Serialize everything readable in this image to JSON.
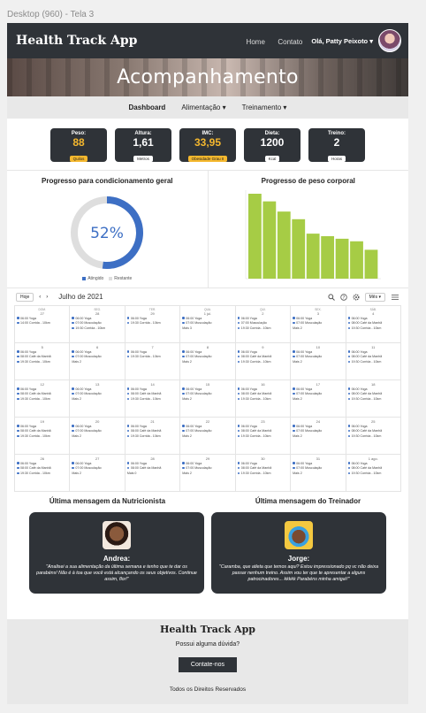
{
  "canvas_label": "Desktop (960) - Tela 3",
  "header": {
    "brand": "Health Track App",
    "nav": [
      "Home",
      "Contato"
    ],
    "user_label": "Olá, Patty Peixoto ▾"
  },
  "hero_title": "Acompanhamento",
  "subnav": [
    {
      "label": "Dashboard",
      "active": true
    },
    {
      "label": "Alimentação ▾",
      "active": false
    },
    {
      "label": "Treinamento ▾",
      "active": false
    }
  ],
  "stats": [
    {
      "label": "Peso:",
      "value": "88",
      "unit": "Quilos",
      "highlight": true
    },
    {
      "label": "Altura:",
      "value": "1,61",
      "unit": "Metros",
      "highlight": false
    },
    {
      "label": "IMC:",
      "value": "33,95",
      "unit": "Obesidade Grau II",
      "highlight": true
    },
    {
      "label": "Dieta:",
      "value": "1200",
      "unit": "Kcal",
      "highlight": false
    },
    {
      "label": "Treino:",
      "value": "2",
      "unit": "Horas",
      "highlight": false
    }
  ],
  "chart_data": [
    {
      "type": "pie",
      "title": "Progresso para condicionamento geral",
      "center_label": "52%",
      "slices": [
        {
          "name": "Atingido",
          "value": 52,
          "color": "#3d6fc4"
        },
        {
          "name": "Restante",
          "value": 48,
          "color": "#dedede"
        }
      ],
      "legend": "bottom"
    },
    {
      "type": "bar",
      "title": "Progresso de peso corporal",
      "values": [
        100,
        91,
        79,
        70,
        53,
        50,
        47,
        44,
        34
      ],
      "color": "#a6cc45",
      "ylim": [
        0,
        100
      ],
      "grid": false
    }
  ],
  "calendar": {
    "today_label": "Hoje",
    "prev": "‹",
    "next": "›",
    "month_label": "Julho de 2021",
    "view_label": "Mês ▾",
    "weekdays": [
      "DOM.",
      "SEG.",
      "TER.",
      "QUA.",
      "QUI.",
      "SEX.",
      "SÁB."
    ],
    "weeks": [
      [
        {
          "day": "27",
          "events": [
            "06:00 Yoga",
            "14:00 Corrida - 10km"
          ]
        },
        {
          "day": "28",
          "events": [
            "06:00 Yoga",
            "07:00 Musculação",
            "19:30 Corrida - 10km"
          ]
        },
        {
          "day": "29",
          "events": [
            "06:00 Yoga",
            "19:30 Corrida - 10km"
          ]
        },
        {
          "day": "1 jul.",
          "events": [
            "06:00 Yoga",
            "07:00 Musculação"
          ],
          "more": "Mais 3"
        },
        {
          "day": "2",
          "events": [
            "06:00 Yoga",
            "07:00 Musculação",
            "19:30 Corrida - 10km"
          ]
        },
        {
          "day": "3",
          "events": [
            "06:00 Yoga",
            "07:00 Musculação"
          ],
          "more": "Mais 2"
        },
        {
          "day": "4",
          "events": [
            "06:00 Yoga",
            "08:00 Café da Manhã",
            "19:30 Corrida - 10km"
          ]
        }
      ],
      [
        {
          "day": "5",
          "events": [
            "06:00 Yoga",
            "08:00 Café da Manhã",
            "19:30 Corrida - 10km"
          ]
        },
        {
          "day": "6",
          "events": [
            "06:00 Yoga",
            "07:00 Musculação"
          ],
          "more": "Mais 2"
        },
        {
          "day": "7",
          "events": [
            "06:00 Yoga",
            "19:30 Corrida - 10km"
          ]
        },
        {
          "day": "8",
          "events": [
            "06:00 Yoga",
            "07:00 Musculação"
          ],
          "more": "Mais 2"
        },
        {
          "day": "9",
          "events": [
            "06:00 Yoga",
            "08:00 Café da Manhã",
            "19:30 Corrida - 10km"
          ]
        },
        {
          "day": "10",
          "events": [
            "06:00 Yoga",
            "07:00 Musculação"
          ],
          "more": "Mais 2"
        },
        {
          "day": "11",
          "events": [
            "06:00 Yoga",
            "08:00 Café da Manhã",
            "19:30 Corrida - 10km"
          ]
        }
      ],
      [
        {
          "day": "12",
          "events": [
            "06:00 Yoga",
            "08:00 Café da Manhã",
            "19:30 Corrida - 10km"
          ]
        },
        {
          "day": "13",
          "events": [
            "06:00 Yoga",
            "07:00 Musculação"
          ],
          "more": "Mais 2"
        },
        {
          "day": "14",
          "events": [
            "06:00 Yoga",
            "08:00 Café da Manhã",
            "19:30 Corrida - 10km"
          ]
        },
        {
          "day": "15",
          "events": [
            "06:00 Yoga",
            "07:00 Musculação"
          ],
          "more": "Mais 2"
        },
        {
          "day": "16",
          "events": [
            "06:00 Yoga",
            "08:00 Café da Manhã",
            "19:30 Corrida - 10km"
          ]
        },
        {
          "day": "17",
          "events": [
            "06:00 Yoga",
            "07:00 Musculação"
          ],
          "more": "Mais 2"
        },
        {
          "day": "18",
          "events": [
            "06:00 Yoga",
            "08:00 Café da Manhã",
            "19:30 Corrida - 10km"
          ]
        }
      ],
      [
        {
          "day": "19",
          "events": [
            "06:00 Yoga",
            "08:00 Café da Manhã",
            "19:30 Corrida - 10km"
          ]
        },
        {
          "day": "20",
          "events": [
            "06:00 Yoga",
            "07:00 Musculação"
          ],
          "more": "Mais 2"
        },
        {
          "day": "21",
          "events": [
            "06:00 Yoga",
            "08:00 Café da Manhã",
            "19:30 Corrida - 10km"
          ]
        },
        {
          "day": "22",
          "events": [
            "06:00 Yoga",
            "07:00 Musculação"
          ],
          "more": "Mais 2"
        },
        {
          "day": "23",
          "events": [
            "06:00 Yoga",
            "08:00 Café da Manhã",
            "19:30 Corrida - 10km"
          ]
        },
        {
          "day": "24",
          "events": [
            "06:00 Yoga",
            "07:00 Musculação"
          ],
          "more": "Mais 2"
        },
        {
          "day": "25",
          "events": [
            "06:00 Yoga",
            "08:00 Café da Manhã",
            "19:30 Corrida - 10km"
          ]
        }
      ],
      [
        {
          "day": "26",
          "events": [
            "06:00 Yoga",
            "08:00 Café da Manhã",
            "19:30 Corrida - 10km"
          ]
        },
        {
          "day": "27",
          "events": [
            "06:00 Yoga",
            "07:00 Musculação"
          ],
          "more": "Mais 2"
        },
        {
          "day": "28",
          "events": [
            "06:00 Yoga",
            "08:00 Café da Manhã"
          ],
          "more": "Mais 0"
        },
        {
          "day": "29",
          "events": [
            "06:00 Yoga",
            "07:00 Musculação"
          ],
          "more": "Mais 2"
        },
        {
          "day": "30",
          "events": [
            "06:00 Yoga",
            "08:00 Café da Manhã",
            "19:30 Corrida - 10km"
          ]
        },
        {
          "day": "31",
          "events": [
            "06:00 Yoga",
            "07:00 Musculação"
          ],
          "more": "Mais 2"
        },
        {
          "day": "1 ago.",
          "events": [
            "06:00 Yoga",
            "08:00 Café da Manhã",
            "19:30 Corrida - 10km"
          ]
        }
      ]
    ]
  },
  "messages": [
    {
      "heading": "Última mensagem da Nutricionista",
      "name": "Andrea:",
      "text": "\"Analisei a sua alimentação da última semana e tenho que te dar os parabéns! Não é à toa que você está alcançando os seus objetivos. Continue assim, flor!\"",
      "avatar": "nutritionist-photo"
    },
    {
      "heading": "Última mensagem do Treinador",
      "name": "Jorge:",
      "text": "\"Caramba, que atleta que temos aqui? Estou impressionado pq vc não deixa passar nenhum treino. Assim vou ter que te apresentar a alguns patrocinadores... kkkkk Parabéns minha amiga!!\"",
      "avatar": "trainer-photo"
    }
  ],
  "footer": {
    "brand": "Health Track App",
    "question": "Possui alguma dúvida?",
    "cta": "Contate-nos",
    "rights": "Todos os Direitos Reservados"
  },
  "colors": {
    "dark": "#2f3338",
    "accent": "#f5b82e",
    "pie_fill": "#3d6fc4",
    "bar": "#a6cc45",
    "event_dot": "#3d6fc4"
  }
}
